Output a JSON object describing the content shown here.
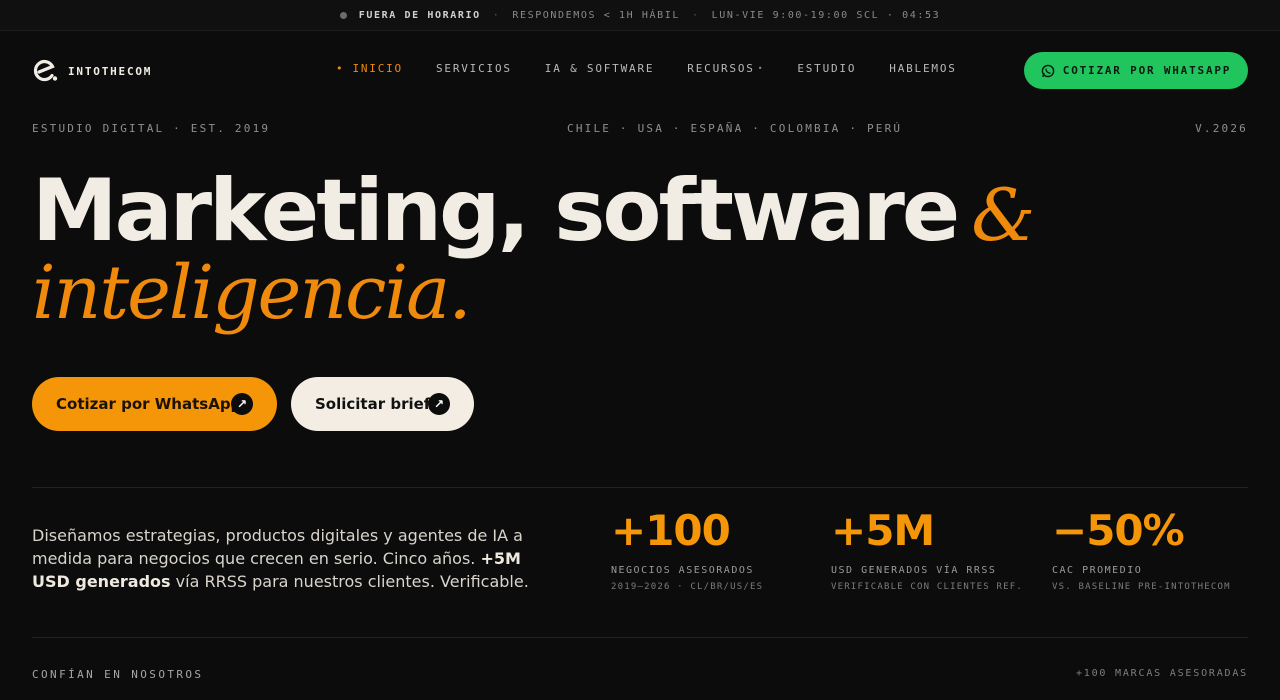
{
  "topbar": {
    "status": "FUERA DE HORARIO",
    "response": "RESPONDEMOS < 1H HÁBIL",
    "hours": "LUN-VIE 9:00-19:00 SCL · 04:53"
  },
  "brand": {
    "name": "INTOTHECOM"
  },
  "nav": {
    "items": [
      {
        "label": "INICIO"
      },
      {
        "label": "SERVICIOS"
      },
      {
        "label": "IA & SOFTWARE"
      },
      {
        "label": "RECURSOS"
      },
      {
        "label": "ESTUDIO"
      },
      {
        "label": "HABLEMOS"
      }
    ],
    "cta": "COTIZAR POR WHATSAPP"
  },
  "meta": {
    "left": "ESTUDIO DIGITAL · EST. 2019",
    "center": "CHILE · USA · ESPAÑA · COLOMBIA · PERÚ",
    "right": "V.2026"
  },
  "hero": {
    "line1": "Marketing, software",
    "amp": "&",
    "line2": "inteligencia."
  },
  "ctas": {
    "primary": "Cotizar por WhatsApp",
    "secondary": "Solicitar brief"
  },
  "intro": {
    "part1": "Diseñamos estrategias, productos digitales y agentes de IA a medida para negocios que crecen en serio. Cinco años. ",
    "bold": "+5M USD generados",
    "part2": " vía RRSS para nuestros clientes. Verificable."
  },
  "stats": [
    {
      "value": "+100",
      "label": "NEGOCIOS ASESORADOS",
      "sub": "2019–2026 · CL/BR/US/ES"
    },
    {
      "value": "+5M",
      "label": "USD GENERADOS VÍA RRSS",
      "sub": "VERIFICABLE CON CLIENTES REF."
    },
    {
      "value": "−50%",
      "label": "CAC PROMEDIO",
      "sub": "VS. BASELINE PRE-INTOTHECOM"
    }
  ],
  "footer": {
    "left": "CONFÍAN EN NOSOTROS",
    "right": "+100 MARCAS ASESORADAS"
  },
  "colors": {
    "accent": "#f59508",
    "whatsapp": "#21c55d",
    "bg": "#0c0c0c"
  },
  "icons": {
    "logo": "intothecom-logo-icon",
    "whatsapp": "whatsapp-icon",
    "arrow": "arrow-up-right-icon"
  }
}
